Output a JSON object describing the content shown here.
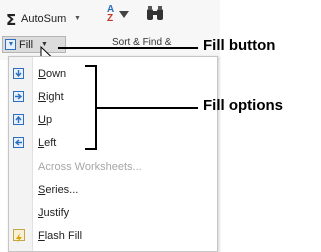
{
  "ribbon": {
    "sigma": "Σ",
    "autosum_label": "AutoSum",
    "autosum_caret": "▼",
    "sort_a": "A",
    "sort_z": "Z",
    "sortfind_label": "Sort & Find &",
    "fill_label": "Fill",
    "fill_caret": "▼"
  },
  "menu": {
    "items": [
      {
        "access": "D",
        "rest": "own",
        "icon": "fill-down-icon"
      },
      {
        "access": "R",
        "rest": "ight",
        "icon": "fill-right-icon"
      },
      {
        "access": "U",
        "rest": "p",
        "icon": "fill-up-icon"
      },
      {
        "access": "L",
        "rest": "eft",
        "icon": "fill-left-icon"
      }
    ],
    "across_worksheets": "Across Worksheets...",
    "series": {
      "access": "S",
      "rest": "eries..."
    },
    "justify": {
      "access": "J",
      "rest": "ustify"
    },
    "flash_fill": {
      "access": "F",
      "rest": "lash Fill",
      "icon": "flash-fill-icon"
    }
  },
  "callouts": {
    "fill_button": "Fill button",
    "fill_options": "Fill options"
  }
}
